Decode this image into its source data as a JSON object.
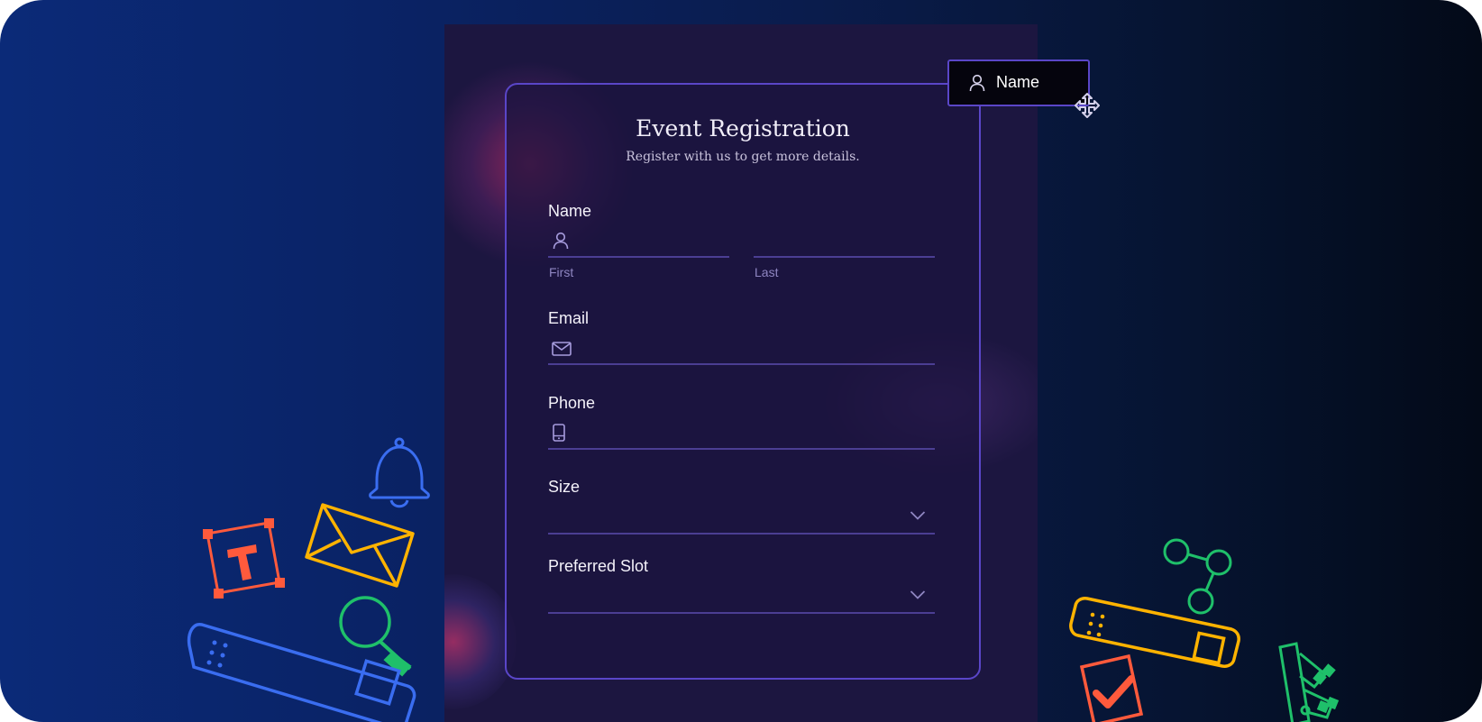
{
  "form": {
    "title": "Event Registration",
    "subtitle": "Register with us to get more details.",
    "fields": {
      "name": {
        "label": "Name",
        "first_sub": "First",
        "last_sub": "Last",
        "first_value": "",
        "last_value": ""
      },
      "email": {
        "label": "Email",
        "value": ""
      },
      "phone": {
        "label": "Phone",
        "value": ""
      },
      "size": {
        "label": "Size",
        "value": ""
      },
      "slot": {
        "label": "Preferred Slot",
        "value": ""
      }
    }
  },
  "drag_chip": {
    "label": "Name",
    "icon": "user-icon"
  },
  "icons": [
    "user-icon",
    "mail-icon",
    "phone-icon",
    "chevron-down-icon",
    "move-cursor-icon",
    "bell-icon",
    "envelope-icon",
    "text-tool-icon",
    "magnifier-icon",
    "input-field-icon",
    "checkbox-icon",
    "share-nodes-icon",
    "color-swatch-icon"
  ],
  "colors": {
    "accent": "#5a46c8",
    "panel": "#1c1640",
    "orange": "#ff5a3c",
    "yellow": "#ffb300",
    "green": "#1fc06a",
    "blue": "#3a6df0"
  }
}
